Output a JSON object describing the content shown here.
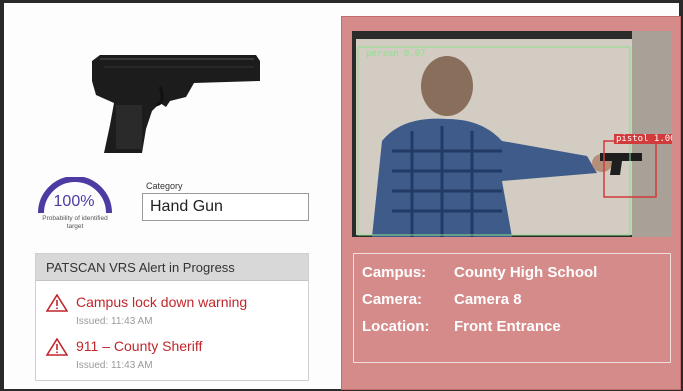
{
  "target": {
    "probability": "100%",
    "probability_caption": "Probability of identified target",
    "probability_fraction": 1.0,
    "category_label": "Category",
    "category_value": "Hand Gun",
    "image_icon": "pistol-image"
  },
  "alert_panel": {
    "header": "PATSCAN VRS Alert in Progress",
    "items": [
      {
        "title": "Campus lock down warning",
        "issued": "Issued: 11:43 AM",
        "icon": "warning-triangle-icon"
      },
      {
        "title": "911 – County Sheriff",
        "issued": "Issued: 11:43 AM",
        "icon": "warning-triangle-icon"
      }
    ]
  },
  "camera_feed": {
    "detections": [
      {
        "label": "person 0.97"
      },
      {
        "label": "pistol 1.00"
      }
    ],
    "info": [
      {
        "key": "Campus:",
        "value": "County High School"
      },
      {
        "key": "Camera:",
        "value": "Camera 8"
      },
      {
        "key": "Location:",
        "value": "Front Entrance"
      }
    ]
  },
  "colors": {
    "alert_red": "#c0262b",
    "gauge_purple": "#4d3aa3",
    "panel_pink": "#d68b8b",
    "pistol_box_red": "#d23b3b",
    "person_box_green": "#8de08d"
  }
}
